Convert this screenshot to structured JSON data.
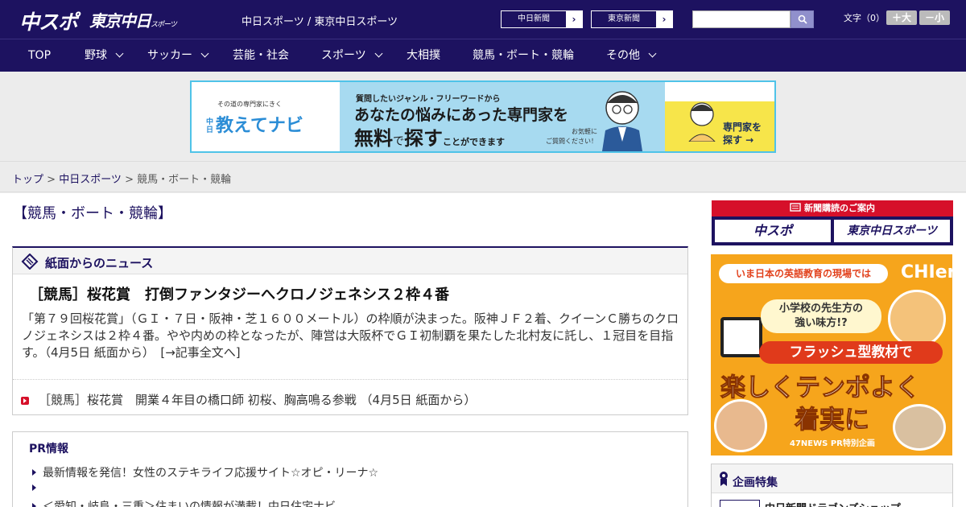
{
  "header": {
    "logo_main": "中スポ",
    "logo_tokyo": "東京中日",
    "logo_tokyo_small": "スポーツ",
    "site_title": "中日スポーツ / 東京中日スポーツ",
    "btn_chunichi": "中日新聞",
    "btn_tokyo": "東京新聞",
    "search_placeholder": "",
    "font_label": "文字（0）",
    "font_larger": "＋大",
    "font_smaller": "－小"
  },
  "nav": {
    "items": [
      {
        "label": "TOP",
        "has_dropdown": false
      },
      {
        "label": "野球",
        "has_dropdown": true
      },
      {
        "label": "サッカー",
        "has_dropdown": true
      },
      {
        "label": "芸能・社会",
        "has_dropdown": false
      },
      {
        "label": "スポーツ",
        "has_dropdown": true
      },
      {
        "label": "大相撲",
        "has_dropdown": false
      },
      {
        "label": "競馬・ボート・競輪",
        "has_dropdown": false
      },
      {
        "label": "その他",
        "has_dropdown": true
      }
    ]
  },
  "banner": {
    "sub": "その道の専門家にきく",
    "brand_prefix": "中日",
    "brand": "教えてナビ",
    "line1": "質問したいジャンル・フリーワードから",
    "line2": "あなたの悩みにあった専門家を",
    "line3_a": "無料",
    "line3_b": "で",
    "line3_c": "探す",
    "line3_d": "ことができます",
    "note": "お気軽に\nご質問ください！",
    "cta": "専門家を\n探す →"
  },
  "breadcrumb": {
    "top": "トップ",
    "sep": " > ",
    "section": "中日スポーツ",
    "current": "競馬・ボート・競輪"
  },
  "page_title": "【競馬・ボート・競輪】",
  "news": {
    "header": "紙面からのニュース",
    "lead_title": "［競馬］桜花賞　打倒ファンタジーへクロノジェネシス２枠４番",
    "lead_body": "「第７９回桜花賞」（ＧＩ・７日・阪神・芝１６００メートル）の枠順が決まった。阪神ＪＦ２着、クイーンＣ勝ちのクロノジェネシスは２枠４番。やや内めの枠となったが、陣営は大阪杯でＧＩ初制覇を果たした北村友に託し、１冠目を目指す。（4月5日 紙面から）　[→記事全文へ]",
    "items": [
      {
        "text": "［競馬］桜花賞　開業４年目の橋口師 初桜、胸高鳴る参戦 （4月5日 紙面から）"
      }
    ]
  },
  "pr": {
    "title": "PR情報",
    "items": [
      {
        "text": "最新情報を発信！女性のステキライフ応援サイト☆オピ・リーナ☆"
      },
      {
        "text": ""
      },
      {
        "text": "＜愛知・岐阜・三重＞住まいの情報が満載！中日住宅ナビ"
      }
    ]
  },
  "sidebar": {
    "subscribe_head": "新聞購読のご案内",
    "sub_btn1": "中スポ",
    "sub_btn2": "東京中日スポーツ",
    "ad": {
      "pill": "いま日本の英語教育の現場では",
      "brand": "CHIeru",
      "question": "小学校の先生方の\n強い味方!?",
      "flash": "フラッシュ型教材で",
      "big1": "楽しくテンポよく",
      "big2": "着実に",
      "foot": "47NEWS PR特別企画"
    },
    "feature_head": "企画特集",
    "feature_item": "中日新聞ドラゴンズショップ"
  },
  "colors": {
    "navy": "#1d1260",
    "red": "#d6102a",
    "banner_border": "#4fc3e8",
    "ad_orange": "#f6a51c"
  }
}
